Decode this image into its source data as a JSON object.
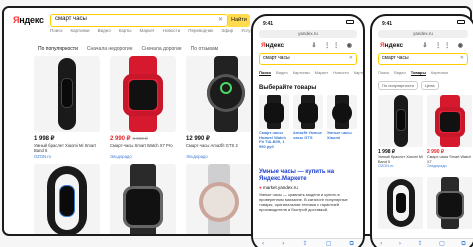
{
  "desktop": {
    "logo_red": "Я",
    "logo_rest": "ндекс",
    "search_value": "смарт часы",
    "find_button": "Найти",
    "nav_tabs": [
      "Поиск",
      "Картинки",
      "Видео",
      "Карты",
      "Маркет",
      "Новости",
      "Переводчик",
      "Эфир",
      "Услуги"
    ],
    "filters": [
      "По популярности",
      "Сначала недорогие",
      "Сначала дорогие",
      "По отзывам"
    ],
    "products": [
      {
        "price": "1 998 ₽",
        "old": "",
        "name": "Умный браслет Xiaomi Mi Smart Band 5",
        "shop": "OZON.ru"
      },
      {
        "price": "2 990 ₽",
        "old": "3 990 ₽",
        "name": "Смарт-часы Smart Watch X7 Pro",
        "shop": "Эльдорадо"
      },
      {
        "price": "12 990 ₽",
        "old": "",
        "name": "Смарт-часы Amazfit GTS 2",
        "shop": "Эльдорадо"
      },
      {
        "price": "8 990 ₽",
        "old": "",
        "name": "Смарт-часы Samsung Galaxy Watch Active 2",
        "shop": "Мвидео"
      },
      {
        "price": "",
        "old": "",
        "name": "",
        "shop": ""
      },
      {
        "price": "",
        "old": "",
        "name": "",
        "shop": ""
      },
      {
        "price": "",
        "old": "",
        "name": "",
        "shop": ""
      },
      {
        "price": "",
        "old": "",
        "name": "",
        "shop": ""
      }
    ]
  },
  "phone1": {
    "time": "9:41",
    "url": "yandex.ru",
    "logo_red": "Я",
    "logo_rest": "ндекс",
    "search_value": "смарт часы",
    "tabs": [
      "Поиск",
      "Видео",
      "Картинки",
      "Маркет",
      "Новости",
      "Карты"
    ],
    "select_title": "Выберайте товары",
    "cards": [
      {
        "title": "Смарт-часы Huawei Watch Fit TIA-B09, 1 990 руб",
        "name": "",
        "price": ""
      },
      {
        "title": "Amazfit Умные часы GTS",
        "name": "",
        "price": ""
      },
      {
        "title": "Умные часы Xiaomi",
        "name": "",
        "price": ""
      }
    ],
    "market_title": "Умные часы — купить на Яндекс.Маркете",
    "market_domain": "market.yandex.ru",
    "market_text": "Умные часы — сравнить модели и купить в проверенном магазине. В каталоге популярные товары, оригинальная техника с гарантией производителя и быстрой доставкой.",
    "bottom_icons": [
      "‹",
      "›",
      "⇪",
      "▢",
      "⧉"
    ]
  },
  "phone2": {
    "time": "9:41",
    "url": "yandex.ru",
    "logo_red": "Я",
    "logo_rest": "ндекс",
    "search_value": "смарт часы",
    "tabs": [
      "Поиск",
      "Видео",
      "Товары",
      "Картинки"
    ],
    "chips": [
      "По популярности",
      "Цена"
    ],
    "products": [
      {
        "price": "1 998 ₽",
        "name": "Умный браслет Xiaomi Mi Band 5",
        "shop": "OZON.ru"
      },
      {
        "price": "2 990 ₽",
        "name": "Смарт-часы Smart Watch X7",
        "shop": "Эльдорадо"
      },
      {
        "price": "",
        "name": "",
        "shop": ""
      },
      {
        "price": "",
        "name": "",
        "shop": ""
      }
    ],
    "bottom_icons": [
      "‹",
      "›",
      "⇪",
      "▢",
      "⧉"
    ]
  }
}
